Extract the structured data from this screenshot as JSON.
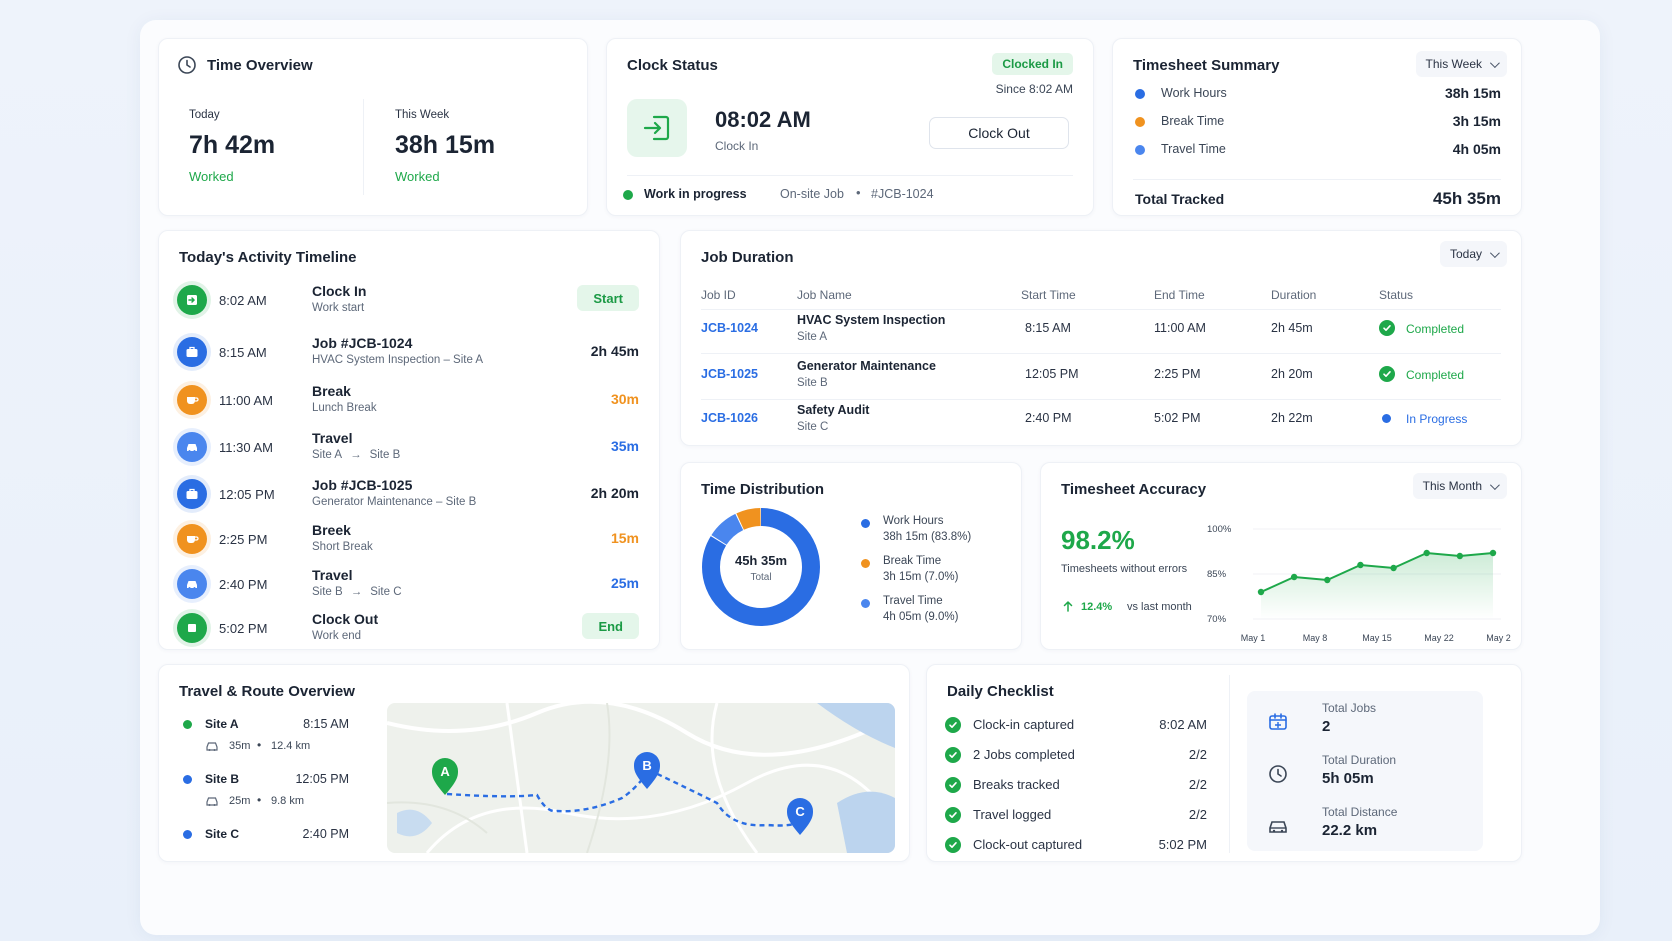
{
  "time_overview": {
    "title": "Time Overview",
    "today_label": "Today",
    "today_value": "7h 42m",
    "today_sub": "Worked",
    "week_label": "This Week",
    "week_value": "38h 15m",
    "week_sub": "Worked"
  },
  "clock_status": {
    "title": "Clock Status",
    "badge": "Clocked In",
    "since": "Since 8:02 AM",
    "time": "08:02 AM",
    "time_label": "Clock In",
    "button": "Clock Out",
    "status": "Work in progress",
    "job_type": "On-site Job",
    "job_id": "#JCB-1024"
  },
  "timesheet_summary": {
    "title": "Timesheet Summary",
    "range": "This Week",
    "items": [
      {
        "label": "Work Hours",
        "value": "38h 15m",
        "color": "#2a6de3"
      },
      {
        "label": "Break Time",
        "value": "3h 15m",
        "color": "#f0921f"
      },
      {
        "label": "Travel Time",
        "value": "4h 05m",
        "color": "#4a86ee"
      }
    ],
    "total_label": "Total Tracked",
    "total_value": "45h 35m"
  },
  "timeline": {
    "title": "Today's Activity Timeline",
    "items": [
      {
        "time": "8:02 AM",
        "title": "Clock In",
        "sub": "Work start",
        "right": "Start",
        "kind": "clockin"
      },
      {
        "time": "8:15 AM",
        "title": "Job #JCB-1024",
        "sub": "HVAC System Inspection – Site A",
        "right": "2h 45m",
        "kind": "job"
      },
      {
        "time": "11:00 AM",
        "title": "Break",
        "sub": "Lunch Break",
        "right": "30m",
        "kind": "break"
      },
      {
        "time": "11:30 AM",
        "title": "Travel",
        "sub_from": "Site A",
        "sub_to": "Site B",
        "right": "35m",
        "kind": "travel"
      },
      {
        "time": "12:05 PM",
        "title": "Job #JCB-1025",
        "sub": "Generator Maintenance – Site B",
        "right": "2h 20m",
        "kind": "job"
      },
      {
        "time": "2:25 PM",
        "title": "Breek",
        "sub": "Short Break",
        "right": "15m",
        "kind": "break"
      },
      {
        "time": "2:40 PM",
        "title": "Travel",
        "sub_from": "Site B",
        "sub_to": "Site C",
        "right": "25m",
        "kind": "travel"
      },
      {
        "time": "5:02 PM",
        "title": "Clock Out",
        "sub": "Work end",
        "right": "End",
        "kind": "clockout"
      }
    ]
  },
  "job_duration": {
    "title": "Job Duration",
    "range": "Today",
    "headers": [
      "Job ID",
      "Job Name",
      "Start Time",
      "End Time",
      "Duration",
      "Status"
    ],
    "rows": [
      {
        "id": "JCB-1024",
        "name": "HVAC System Inspection",
        "site": "Site A",
        "start": "8:15 AM",
        "end": "11:00 AM",
        "duration": "2h 45m",
        "status": "Completed"
      },
      {
        "id": "JCB-1025",
        "name": "Generator Maintenance",
        "site": "Site B",
        "start": "12:05 PM",
        "end": "2:25 PM",
        "duration": "2h 20m",
        "status": "Completed"
      },
      {
        "id": "JCB-1026",
        "name": "Safety Audit",
        "site": "Site C",
        "start": "2:40 PM",
        "end": "5:02 PM",
        "duration": "2h 22m",
        "status": "In Progress"
      }
    ]
  },
  "time_distribution": {
    "title": "Time Distribution",
    "center_value": "45h 35m",
    "center_label": "Total",
    "items": [
      {
        "label": "Work Hours",
        "value": "38h 15m (83.8%)",
        "color": "#2a6de3"
      },
      {
        "label": "Break Time",
        "value": "3h 15m (7.0%)",
        "color": "#f0921f"
      },
      {
        "label": "Travel Time",
        "value": "4h 05m (9.0%)",
        "color": "#4a86ee"
      }
    ]
  },
  "accuracy": {
    "title": "Timesheet Accuracy",
    "range": "This Month",
    "value": "98.2%",
    "caption": "Timesheets without errors",
    "delta": "12.4%",
    "delta_caption": "vs last month"
  },
  "chart_data": {
    "type": "line",
    "title": "",
    "xlabel": "",
    "ylabel": "",
    "y_ticks": [
      "100%",
      "85%",
      "70%"
    ],
    "x_ticks": [
      "May 1",
      "May 8",
      "May 15",
      "May 22",
      "May 29"
    ],
    "ylim": [
      70,
      100
    ],
    "series": [
      {
        "values": [
          79,
          84,
          83,
          88,
          87,
          92,
          91,
          92
        ]
      }
    ]
  },
  "route": {
    "title": "Travel & Route Overview",
    "stops": [
      {
        "name": "Site A",
        "time": "8:15 AM",
        "leg_time": "35m",
        "leg_dist": "12.4 km",
        "color": "#1ea84a"
      },
      {
        "name": "Site B",
        "time": "12:05 PM",
        "leg_time": "25m",
        "leg_dist": "9.8 km",
        "color": "#2a6de3"
      },
      {
        "name": "Site C",
        "time": "2:40 PM",
        "color": "#2a6de3"
      }
    ],
    "markers": [
      "A",
      "B",
      "C"
    ]
  },
  "checklist": {
    "title": "Daily Checklist",
    "items": [
      {
        "label": "Clock-in captured",
        "value": "8:02 AM"
      },
      {
        "label": "2 Jobs completed",
        "value": "2/2"
      },
      {
        "label": "Breaks tracked",
        "value": "2/2"
      },
      {
        "label": "Travel logged",
        "value": "2/2"
      },
      {
        "label": "Clock-out captured",
        "value": "5:02 PM"
      }
    ],
    "stats": [
      {
        "label": "Total Jobs",
        "value": "2"
      },
      {
        "label": "Total Duration",
        "value": "5h 05m"
      },
      {
        "label": "Total Distance",
        "value": "22.2 km"
      }
    ]
  }
}
